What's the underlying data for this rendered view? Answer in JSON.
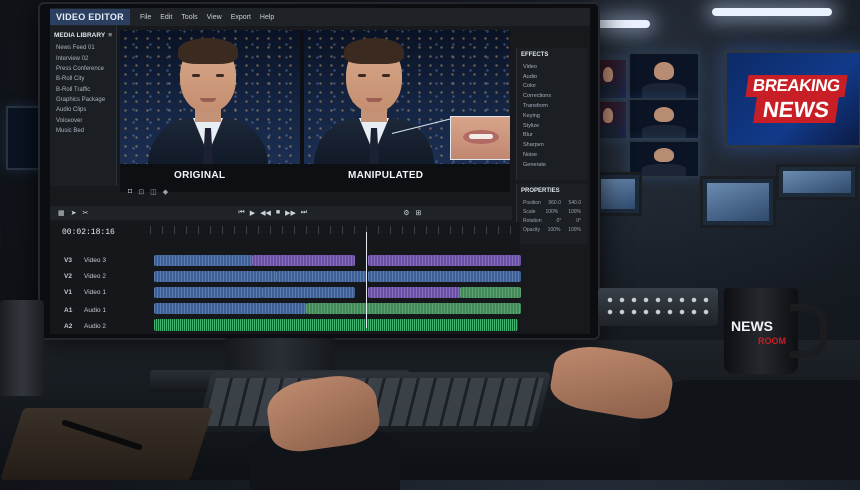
{
  "app": {
    "title": "VIDEO EDITOR",
    "menu": [
      "File",
      "Edit",
      "Tools",
      "View",
      "Export",
      "Help"
    ]
  },
  "library": {
    "header": "MEDIA LIBRARY",
    "items": [
      "News Feed 01",
      "Interview 02",
      "Press Conference",
      "B-Roll City",
      "B-Roll Traffic",
      "Graphics Package",
      "Audio Clips",
      "Voiceover",
      "Music Bed"
    ]
  },
  "viewer": {
    "left_label": "ORIGINAL",
    "right_label": "MANIPULATED"
  },
  "effects": {
    "header": "EFFECTS",
    "items": [
      "Video",
      "Audio",
      "Color",
      "Corrections",
      "Transform",
      "Keying",
      "Stylize",
      "Blur",
      "Sharpen",
      "Noise",
      "Generate"
    ]
  },
  "properties": {
    "header": "PROPERTIES",
    "rows": [
      {
        "name": "Position",
        "a": "960.0",
        "b": "540.0"
      },
      {
        "name": "Scale",
        "a": "100%",
        "b": "100%"
      },
      {
        "name": "Rotation",
        "a": "0°",
        "b": "0°"
      },
      {
        "name": "Opacity",
        "a": "100%",
        "b": "100%"
      }
    ]
  },
  "timeline": {
    "timecode": "00:02:18:16",
    "tracks": [
      {
        "id": "V3",
        "name": "Video 3"
      },
      {
        "id": "V2",
        "name": "Video 2"
      },
      {
        "id": "V1",
        "name": "Video 1"
      },
      {
        "id": "A1",
        "name": "Audio 1"
      },
      {
        "id": "A2",
        "name": "Audio 2"
      }
    ]
  },
  "background": {
    "wall_screen_line1": "BREAKING",
    "wall_screen_line2": "NEWS",
    "mug_line1": "NEWS",
    "mug_line2": "ROOM"
  },
  "colors": {
    "accent": "#2b3f61",
    "clip_blue": "#3b5f96",
    "clip_purple": "#6a4fa6",
    "clip_green": "#3f8a57",
    "breaking_red": "#c81e25"
  }
}
